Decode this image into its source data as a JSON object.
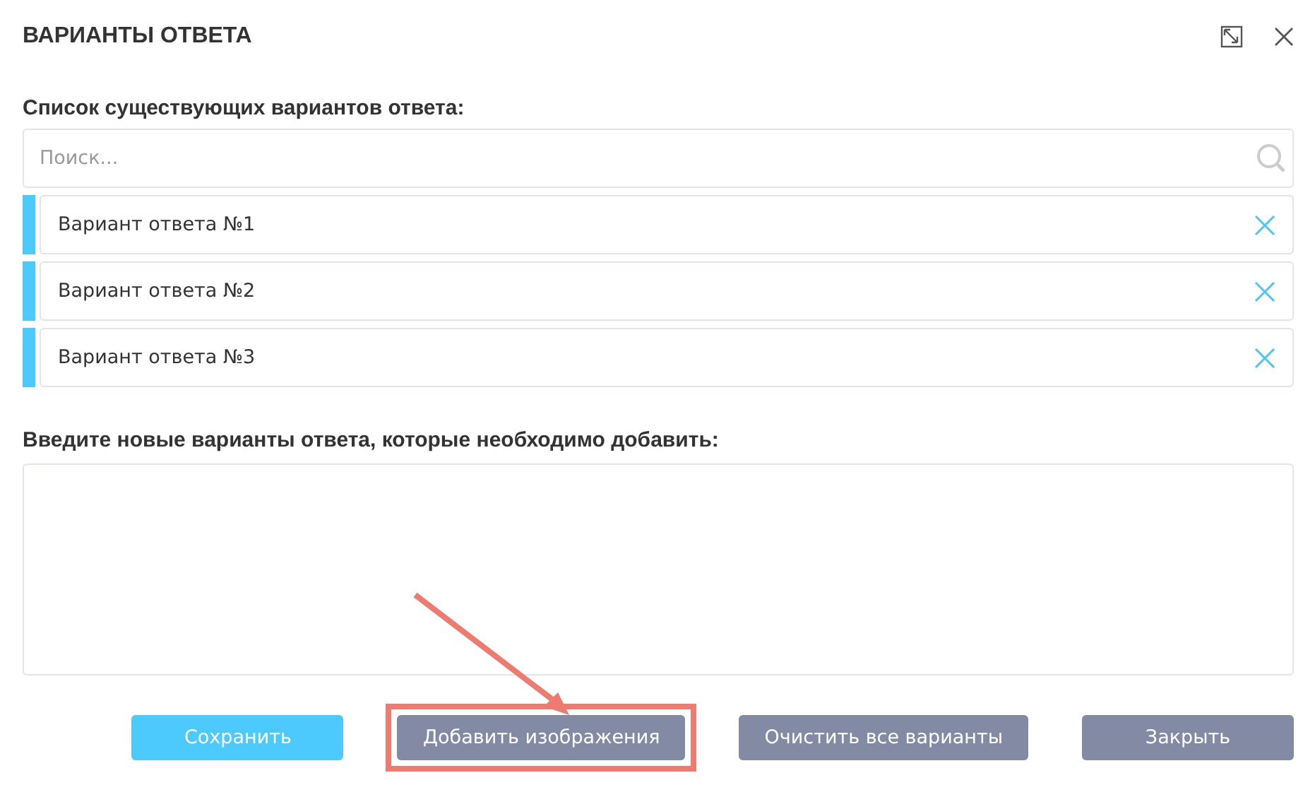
{
  "dialog": {
    "title": "ВАРИАНТЫ ОТВЕТА"
  },
  "existing": {
    "label": "Список существующих вариантов ответа:",
    "search": {
      "placeholder": "Поиск..."
    },
    "options": [
      {
        "text": "Вариант ответа №1"
      },
      {
        "text": "Вариант ответа №2"
      },
      {
        "text": "Вариант ответа №3"
      }
    ]
  },
  "new_options": {
    "label": "Введите новые варианты ответа, которые необходимо добавить:"
  },
  "buttons": [
    {
      "label": "Сохранить",
      "kind": "primary",
      "highlighted": false
    },
    {
      "label": "Добавить изображения",
      "kind": "secondary",
      "highlighted": true
    },
    {
      "label": "Очистить все варианты",
      "kind": "secondary",
      "highlighted": false
    },
    {
      "label": "Закрыть",
      "kind": "secondary",
      "highlighted": false
    }
  ]
}
